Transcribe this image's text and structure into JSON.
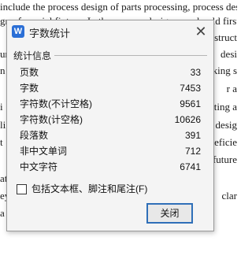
{
  "background_document": {
    "lines": [
      {
        "left": "include the process design of parts processing, process desig",
        "right": ""
      },
      {
        "left": "gn of special fixture. In the process design, we should first a",
        "right": ""
      },
      {
        "left": "",
        "right": "struct"
      },
      {
        "left": "unk",
        "right": "desi"
      },
      {
        "left": "n",
        "right": "rking s"
      },
      {
        "left": "",
        "right": "r a"
      },
      {
        "left": "i",
        "right": "tting a"
      },
      {
        "left": "li",
        "right": "d desig"
      },
      {
        "left": "t",
        "right": "deficie"
      },
      {
        "left": "",
        "right": "future"
      },
      {
        "left": "ati",
        "right": ""
      },
      {
        "left": "ey",
        "right": "clar"
      },
      {
        "left": "a",
        "right": ""
      }
    ]
  },
  "dialog": {
    "app_icon_glyph": "W",
    "title": "字数统计",
    "close_glyph": "✕",
    "section_title": "统计信息",
    "stats": [
      {
        "label": "页数",
        "value": "33"
      },
      {
        "label": "字数",
        "value": "7453"
      },
      {
        "label": "字符数(不计空格)",
        "value": "9561"
      },
      {
        "label": "字符数(计空格)",
        "value": "10626"
      },
      {
        "label": "段落数",
        "value": "391"
      },
      {
        "label": "非中文单词",
        "value": "712"
      },
      {
        "label": "中文字符",
        "value": "6741"
      }
    ],
    "include_textboxes_label": "包括文本框、脚注和尾注(F)",
    "include_textboxes_checked": false,
    "close_button_label": "关闭"
  },
  "colors": {
    "accent": "#2f6fb8",
    "app_icon": "#2b6fd6",
    "dialog_bg": "#f4f4f4"
  }
}
